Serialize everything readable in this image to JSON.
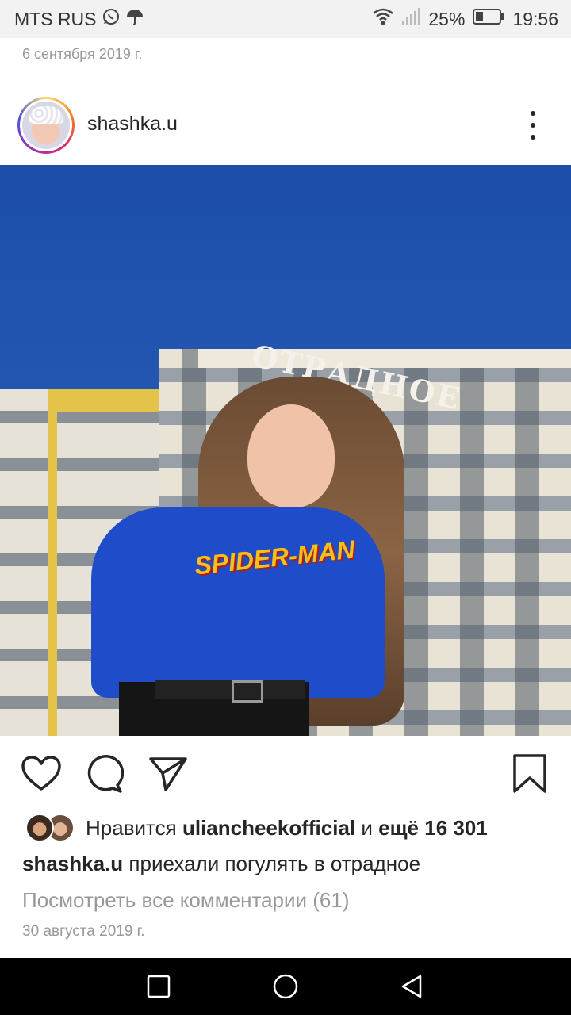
{
  "status_bar": {
    "carrier": "MTS RUS",
    "battery_percent": "25%",
    "time": "19:56",
    "icons": [
      "whatsapp-icon",
      "umbrella-icon",
      "wifi-icon",
      "signal-icon",
      "battery-icon"
    ]
  },
  "previous_post": {
    "date": "6 сентября 2019 г."
  },
  "post": {
    "username": "shashka.u",
    "photo_sign_text": "ОТРАДНОЕ",
    "photo_shirt_text": "SPIDER-MAN",
    "actions": [
      "heart-icon",
      "comment-icon",
      "send-icon",
      "bookmark-icon"
    ],
    "likes": {
      "prefix": "Нравится",
      "liker": "ulianchеekofficial",
      "connector": "и",
      "others": "ещё 16 301"
    },
    "caption": {
      "username": "shashka.u",
      "text": "приехали погулять в отрадное"
    },
    "view_comments": "Посмотреть все комментарии (61)",
    "date": "30 августа 2019 г."
  },
  "nav_bar": {
    "icons": [
      "recent-apps-icon",
      "home-icon",
      "back-icon"
    ]
  },
  "colors": {
    "accent_text": "#262626",
    "muted_text": "#999999",
    "status_bar_bg": "#f2f2f2",
    "nav_bar_bg": "#000000"
  }
}
